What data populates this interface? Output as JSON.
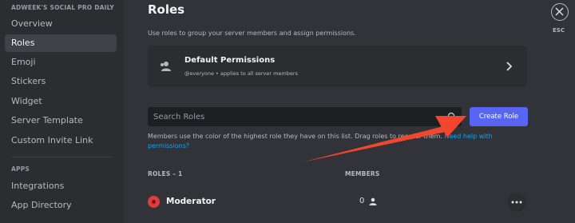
{
  "sidebar": {
    "section_title": "ADWEEK'S SOCIAL PRO DAILY",
    "items": [
      {
        "label": "Overview"
      },
      {
        "label": "Roles"
      },
      {
        "label": "Emoji"
      },
      {
        "label": "Stickers"
      },
      {
        "label": "Widget"
      },
      {
        "label": "Server Template"
      },
      {
        "label": "Custom Invite Link"
      }
    ],
    "apps_title": "APPS",
    "apps_items": [
      {
        "label": "Integrations"
      },
      {
        "label": "App Directory"
      }
    ],
    "active_item": "Roles"
  },
  "header": {
    "title": "Roles",
    "description": "Use roles to group your server members and assign permissions."
  },
  "default_permissions": {
    "title": "Default Permissions",
    "subtitle": "@everyone • applies to all server members"
  },
  "search": {
    "placeholder": "Search Roles"
  },
  "create_role_label": "Create Role",
  "info": {
    "text": "Members use the color of the highest role they have on this list. Drag roles to reorder them.",
    "link_text": "Need help with permissions?"
  },
  "table": {
    "roles_header": "ROLES – 1",
    "members_header": "MEMBERS",
    "rows": [
      {
        "name": "Moderator",
        "members": "0",
        "color": "#e03c3c"
      }
    ]
  },
  "close": {
    "esc_label": "ESC"
  },
  "colors": {
    "accent": "#5865f2",
    "annotation_arrow": "#f2472e"
  }
}
